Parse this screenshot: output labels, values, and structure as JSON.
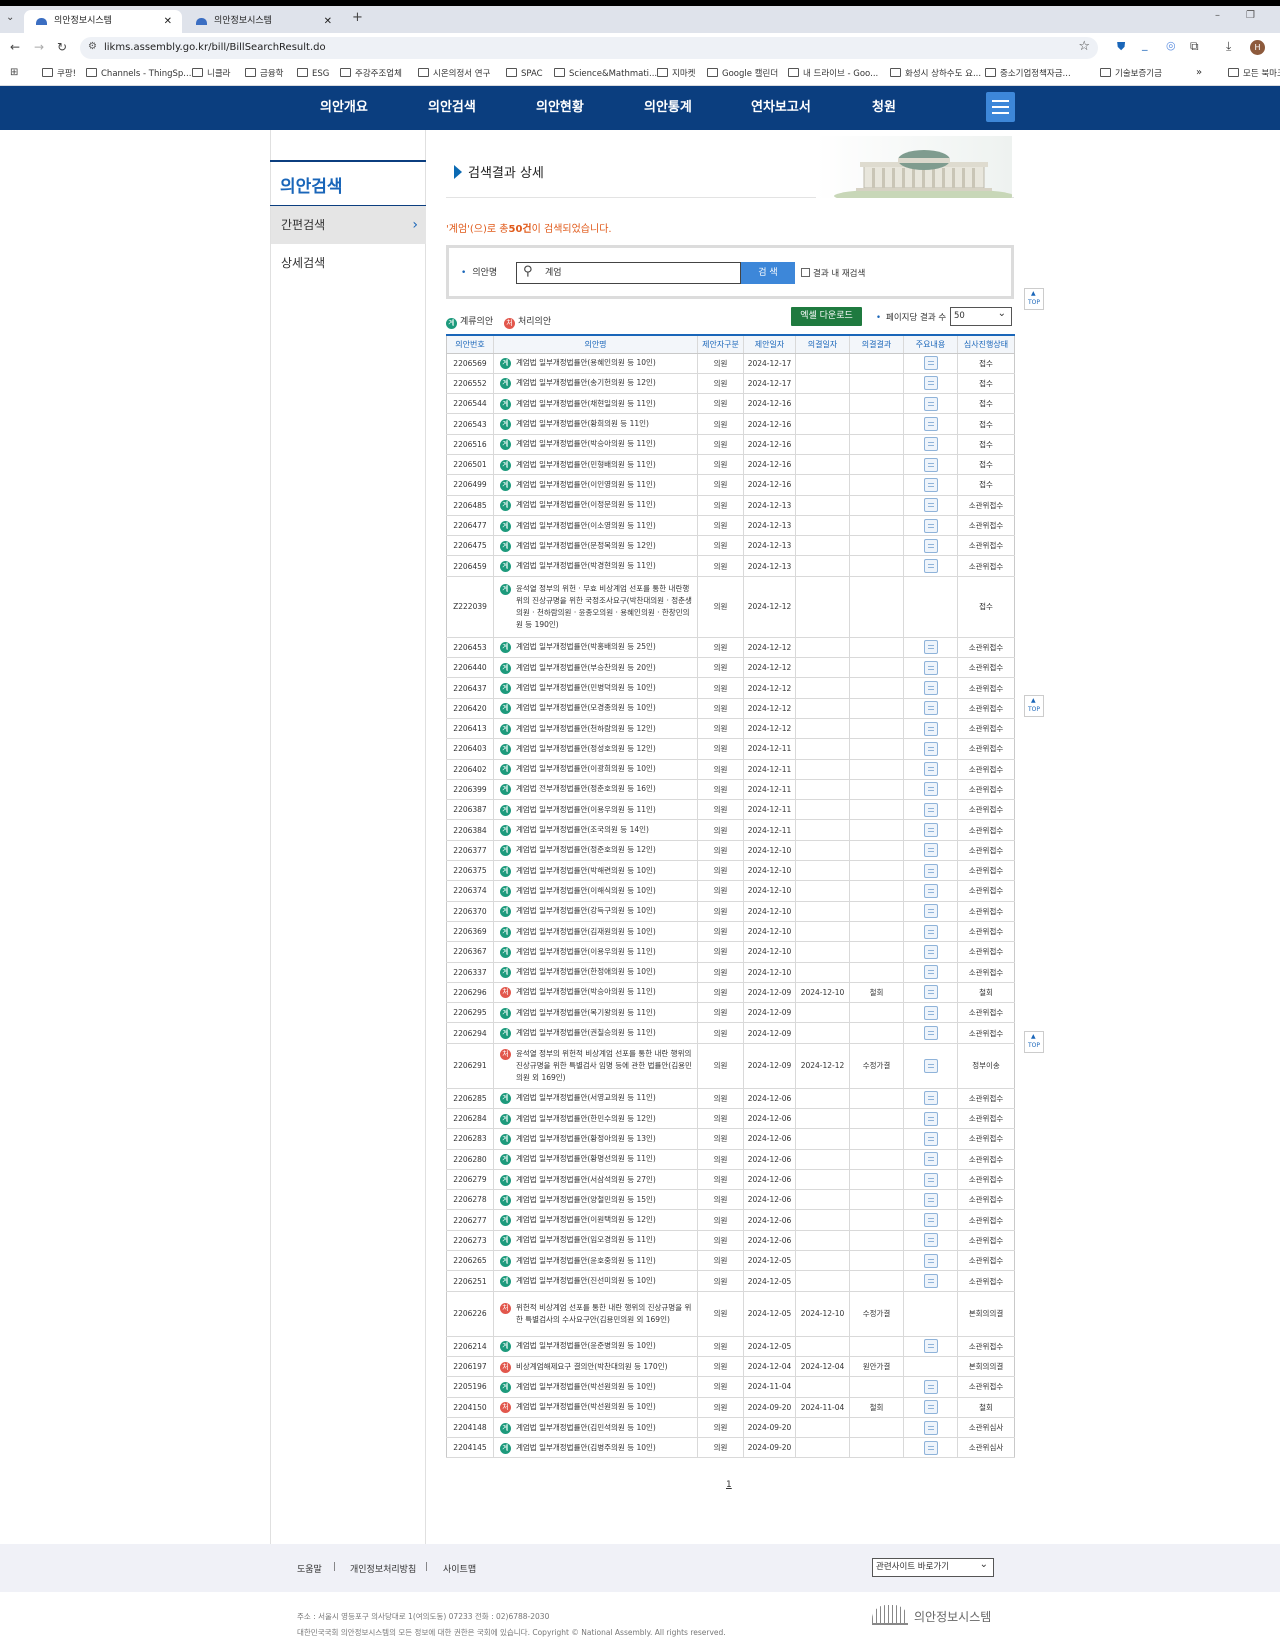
{
  "browser": {
    "tabs": [
      {
        "label": "의안정보시스템",
        "active": true
      },
      {
        "label": "의안정보시스템",
        "active": false
      }
    ],
    "url": "likms.assembly.go.kr/bill/BillSearchResult.do",
    "bookmarks": [
      "쿠팡!",
      "Channels - ThingSp...",
      "니클라",
      "금융학",
      "ESG",
      "주강주조업체",
      "시온의정서 연구",
      "SPAC",
      "Science&Mathmati...",
      "지마켓",
      "Google 캘린더",
      "내 드라이브 - Goo...",
      "화성시 상하수도 요...",
      "중소기업정책자금...",
      "기술보증기금",
      "모든 북마크"
    ]
  },
  "gnb": {
    "items": [
      "의안개요",
      "의안검색",
      "의안현황",
      "의안통계",
      "연차보고서",
      "청원"
    ]
  },
  "lnb": {
    "title": "의안검색",
    "items": [
      "간편검색",
      "상세검색"
    ]
  },
  "page": {
    "title": "검색결과 상세",
    "result_message_prefix": "'계엄'(으)로 총",
    "result_count": "50건",
    "result_message_suffix": "이 검색되었습니다."
  },
  "search": {
    "label": "의안명",
    "value": "계엄",
    "button": "검 색",
    "recheck_label": "결과 내 재검색"
  },
  "legend": {
    "pending": "계류의안",
    "processed": "처리의안",
    "pending_badge": "계",
    "processed_badge": "처"
  },
  "toolbar": {
    "excel": "엑셀 다운로드",
    "perpage_label": "페이지당 결과 수",
    "perpage_value": "50"
  },
  "table": {
    "headers": [
      "의안번호",
      "의안명",
      "제안자구분",
      "제안일자",
      "의결일자",
      "의결결과",
      "주요내용",
      "심사진행상태"
    ],
    "rows": [
      {
        "no": "2206569",
        "t": "g",
        "name": "계엄법 일부개정법률안(용혜인의원 등 10인)",
        "prop": "의원",
        "date": "2024-12-17",
        "vdate": "",
        "vres": "",
        "doc": true,
        "status": "접수"
      },
      {
        "no": "2206552",
        "t": "g",
        "name": "계엄법 일부개정법률안(송기헌의원 등 12인)",
        "prop": "의원",
        "date": "2024-12-17",
        "vdate": "",
        "vres": "",
        "doc": true,
        "status": "접수"
      },
      {
        "no": "2206544",
        "t": "g",
        "name": "계엄법 일부개정법률안(채현일의원 등 11인)",
        "prop": "의원",
        "date": "2024-12-16",
        "vdate": "",
        "vres": "",
        "doc": true,
        "status": "접수"
      },
      {
        "no": "2206543",
        "t": "g",
        "name": "계엄법 일부개정법률안(황희의원 등 11인)",
        "prop": "의원",
        "date": "2024-12-16",
        "vdate": "",
        "vres": "",
        "doc": true,
        "status": "접수"
      },
      {
        "no": "2206516",
        "t": "g",
        "name": "계엄법 일부개정법률안(박승아의원 등 11인)",
        "prop": "의원",
        "date": "2024-12-16",
        "vdate": "",
        "vres": "",
        "doc": true,
        "status": "접수"
      },
      {
        "no": "2206501",
        "t": "g",
        "name": "계엄법 일부개정법률안(민형배의원 등 11인)",
        "prop": "의원",
        "date": "2024-12-16",
        "vdate": "",
        "vres": "",
        "doc": true,
        "status": "접수"
      },
      {
        "no": "2206499",
        "t": "g",
        "name": "계엄법 일부개정법률안(이인영의원 등 11인)",
        "prop": "의원",
        "date": "2024-12-16",
        "vdate": "",
        "vres": "",
        "doc": true,
        "status": "접수"
      },
      {
        "no": "2206485",
        "t": "g",
        "name": "계엄법 일부개정법률안(이정문의원 등 11인)",
        "prop": "의원",
        "date": "2024-12-13",
        "vdate": "",
        "vres": "",
        "doc": true,
        "status": "소관위접수"
      },
      {
        "no": "2206477",
        "t": "g",
        "name": "계엄법 일부개정법률안(이소영의원 등 11인)",
        "prop": "의원",
        "date": "2024-12-13",
        "vdate": "",
        "vres": "",
        "doc": true,
        "status": "소관위접수"
      },
      {
        "no": "2206475",
        "t": "g",
        "name": "계엄법 일부개정법률안(문정복의원 등 12인)",
        "prop": "의원",
        "date": "2024-12-13",
        "vdate": "",
        "vres": "",
        "doc": true,
        "status": "소관위접수"
      },
      {
        "no": "2206459",
        "t": "g",
        "name": "계엄법 일부개정법률안(박경현의원 등 11인)",
        "prop": "의원",
        "date": "2024-12-13",
        "vdate": "",
        "vres": "",
        "doc": true,
        "status": "소관위접수"
      },
      {
        "no": "Z222039",
        "t": "g",
        "name": "윤석열 정부의 위헌 · 무효 비상계엄 선포를 통한 내란행위의 진상규명을 위한 국정조사요구(박찬대의원 · 정춘생의원 · 천하람의원 · 윤종오의원 · 용혜인의원 · 한창민의원 등 190인)",
        "prop": "의원",
        "date": "2024-12-12",
        "vdate": "",
        "vres": "",
        "doc": false,
        "status": "접수",
        "size": "tall"
      },
      {
        "no": "2206453",
        "t": "g",
        "name": "계엄법 일부개정법률안(박홍배의원 등 25인)",
        "prop": "의원",
        "date": "2024-12-12",
        "vdate": "",
        "vres": "",
        "doc": true,
        "status": "소관위접수"
      },
      {
        "no": "2206440",
        "t": "g",
        "name": "계엄법 일부개정법률안(부승찬의원 등 20인)",
        "prop": "의원",
        "date": "2024-12-12",
        "vdate": "",
        "vres": "",
        "doc": true,
        "status": "소관위접수"
      },
      {
        "no": "2206437",
        "t": "g",
        "name": "계엄법 일부개정법률안(민병덕의원 등 10인)",
        "prop": "의원",
        "date": "2024-12-12",
        "vdate": "",
        "vres": "",
        "doc": true,
        "status": "소관위접수"
      },
      {
        "no": "2206420",
        "t": "g",
        "name": "계엄법 일부개정법률안(모경종의원 등 10인)",
        "prop": "의원",
        "date": "2024-12-12",
        "vdate": "",
        "vres": "",
        "doc": true,
        "status": "소관위접수"
      },
      {
        "no": "2206413",
        "t": "g",
        "name": "계엄법 일부개정법률안(천하람의원 등 12인)",
        "prop": "의원",
        "date": "2024-12-12",
        "vdate": "",
        "vres": "",
        "doc": true,
        "status": "소관위접수"
      },
      {
        "no": "2206403",
        "t": "g",
        "name": "계엄법 일부개정법률안(정성호의원 등 12인)",
        "prop": "의원",
        "date": "2024-12-11",
        "vdate": "",
        "vres": "",
        "doc": true,
        "status": "소관위접수"
      },
      {
        "no": "2206402",
        "t": "g",
        "name": "계엄법 일부개정법률안(이광희의원 등 10인)",
        "prop": "의원",
        "date": "2024-12-11",
        "vdate": "",
        "vres": "",
        "doc": true,
        "status": "소관위접수"
      },
      {
        "no": "2206399",
        "t": "g",
        "name": "계엄법 전부개정법률안(정춘호의원 등 16인)",
        "prop": "의원",
        "date": "2024-12-11",
        "vdate": "",
        "vres": "",
        "doc": true,
        "status": "소관위접수"
      },
      {
        "no": "2206387",
        "t": "g",
        "name": "계엄법 일부개정법률안(이용우의원 등 11인)",
        "prop": "의원",
        "date": "2024-12-11",
        "vdate": "",
        "vres": "",
        "doc": true,
        "status": "소관위접수"
      },
      {
        "no": "2206384",
        "t": "g",
        "name": "계엄법 일부개정법률안(조국의원 등 14인)",
        "prop": "의원",
        "date": "2024-12-11",
        "vdate": "",
        "vres": "",
        "doc": true,
        "status": "소관위접수"
      },
      {
        "no": "2206377",
        "t": "g",
        "name": "계엄법 일부개정법률안(정준호의원 등 12인)",
        "prop": "의원",
        "date": "2024-12-10",
        "vdate": "",
        "vres": "",
        "doc": true,
        "status": "소관위접수"
      },
      {
        "no": "2206375",
        "t": "g",
        "name": "계엄법 일부개정법률안(박해련의원 등 10인)",
        "prop": "의원",
        "date": "2024-12-10",
        "vdate": "",
        "vres": "",
        "doc": true,
        "status": "소관위접수"
      },
      {
        "no": "2206374",
        "t": "g",
        "name": "계엄법 일부개정법률안(이해식의원 등 10인)",
        "prop": "의원",
        "date": "2024-12-10",
        "vdate": "",
        "vres": "",
        "doc": true,
        "status": "소관위접수"
      },
      {
        "no": "2206370",
        "t": "g",
        "name": "계엄법 일부개정법률안(강득구의원 등 10인)",
        "prop": "의원",
        "date": "2024-12-10",
        "vdate": "",
        "vres": "",
        "doc": true,
        "status": "소관위접수"
      },
      {
        "no": "2206369",
        "t": "g",
        "name": "계엄법 일부개정법률안(김재원의원 등 10인)",
        "prop": "의원",
        "date": "2024-12-10",
        "vdate": "",
        "vres": "",
        "doc": true,
        "status": "소관위접수"
      },
      {
        "no": "2206367",
        "t": "g",
        "name": "계엄법 일부개정법률안(이용우의원 등 11인)",
        "prop": "의원",
        "date": "2024-12-10",
        "vdate": "",
        "vres": "",
        "doc": true,
        "status": "소관위접수"
      },
      {
        "no": "2206337",
        "t": "g",
        "name": "계엄법 일부개정법률안(한정애의원 등 10인)",
        "prop": "의원",
        "date": "2024-12-10",
        "vdate": "",
        "vres": "",
        "doc": true,
        "status": "소관위접수"
      },
      {
        "no": "2206296",
        "t": "r",
        "name": "계엄법 일부개정법률안(박승아의원 등 11인)",
        "prop": "의원",
        "date": "2024-12-09",
        "vdate": "2024-12-10",
        "vres": "철회",
        "doc": true,
        "status": "철회"
      },
      {
        "no": "2206295",
        "t": "g",
        "name": "계엄법 일부개정법률안(복기왕의원 등 11인)",
        "prop": "의원",
        "date": "2024-12-09",
        "vdate": "",
        "vres": "",
        "doc": true,
        "status": "소관위접수"
      },
      {
        "no": "2206294",
        "t": "g",
        "name": "계엄법 일부개정법률안(권칠승의원 등 11인)",
        "prop": "의원",
        "date": "2024-12-09",
        "vdate": "",
        "vres": "",
        "doc": true,
        "status": "소관위접수"
      },
      {
        "no": "2206291",
        "t": "r",
        "name": "윤석열 정부의 위헌적 비상계엄 선포를 통한 내란 행위의 진상규명을 위한 특별검사 임명 등에 관한 법률안(김용민의원 외 169인)",
        "prop": "의원",
        "date": "2024-12-09",
        "vdate": "2024-12-12",
        "vres": "수정가결",
        "doc": true,
        "status": "정부이송",
        "size": "mid"
      },
      {
        "no": "2206285",
        "t": "g",
        "name": "계엄법 일부개정법률안(서영교의원 등 11인)",
        "prop": "의원",
        "date": "2024-12-06",
        "vdate": "",
        "vres": "",
        "doc": true,
        "status": "소관위접수"
      },
      {
        "no": "2206284",
        "t": "g",
        "name": "계엄법 일부개정법률안(한민수의원 등 12인)",
        "prop": "의원",
        "date": "2024-12-06",
        "vdate": "",
        "vres": "",
        "doc": true,
        "status": "소관위접수"
      },
      {
        "no": "2206283",
        "t": "g",
        "name": "계엄법 일부개정법률안(황정아의원 등 13인)",
        "prop": "의원",
        "date": "2024-12-06",
        "vdate": "",
        "vres": "",
        "doc": true,
        "status": "소관위접수"
      },
      {
        "no": "2206280",
        "t": "g",
        "name": "계엄법 일부개정법률안(황명선의원 등 11인)",
        "prop": "의원",
        "date": "2024-12-06",
        "vdate": "",
        "vres": "",
        "doc": true,
        "status": "소관위접수"
      },
      {
        "no": "2206279",
        "t": "g",
        "name": "계엄법 일부개정법률안(서삼석의원 등 27인)",
        "prop": "의원",
        "date": "2024-12-06",
        "vdate": "",
        "vres": "",
        "doc": true,
        "status": "소관위접수"
      },
      {
        "no": "2206278",
        "t": "g",
        "name": "계엄법 일부개정법률안(양철민의원 등 15인)",
        "prop": "의원",
        "date": "2024-12-06",
        "vdate": "",
        "vres": "",
        "doc": true,
        "status": "소관위접수"
      },
      {
        "no": "2206277",
        "t": "g",
        "name": "계엄법 일부개정법률안(이원택의원 등 12인)",
        "prop": "의원",
        "date": "2024-12-06",
        "vdate": "",
        "vres": "",
        "doc": true,
        "status": "소관위접수"
      },
      {
        "no": "2206273",
        "t": "g",
        "name": "계엄법 일부개정법률안(임오경의원 등 11인)",
        "prop": "의원",
        "date": "2024-12-06",
        "vdate": "",
        "vres": "",
        "doc": true,
        "status": "소관위접수"
      },
      {
        "no": "2206265",
        "t": "g",
        "name": "계엄법 일부개정법률안(윤호중의원 등 11인)",
        "prop": "의원",
        "date": "2024-12-05",
        "vdate": "",
        "vres": "",
        "doc": true,
        "status": "소관위접수"
      },
      {
        "no": "2206251",
        "t": "g",
        "name": "계엄법 일부개정법률안(진선미의원 등 10인)",
        "prop": "의원",
        "date": "2024-12-05",
        "vdate": "",
        "vres": "",
        "doc": true,
        "status": "소관위접수"
      },
      {
        "no": "2206226",
        "t": "r",
        "name": "위헌적 비상계엄 선포를 통한 내란 행위의 진상규명을 위한 특별검사의 수사요구안(김용민의원 외 169인)",
        "prop": "의원",
        "date": "2024-12-05",
        "vdate": "2024-12-10",
        "vres": "수정가결",
        "doc": false,
        "status": "본회의의결",
        "size": "mid"
      },
      {
        "no": "2206214",
        "t": "g",
        "name": "계엄법 일부개정법률안(윤준병의원 등 10인)",
        "prop": "의원",
        "date": "2024-12-05",
        "vdate": "",
        "vres": "",
        "doc": true,
        "status": "소관위접수"
      },
      {
        "no": "2206197",
        "t": "r",
        "name": "비상계엄해제요구 결의안(박찬대의원 등 170인)",
        "prop": "의원",
        "date": "2024-12-04",
        "vdate": "2024-12-04",
        "vres": "원안가결",
        "doc": false,
        "status": "본회의의결"
      },
      {
        "no": "2205196",
        "t": "g",
        "name": "계엄법 일부개정법률안(박선원의원 등 10인)",
        "prop": "의원",
        "date": "2024-11-04",
        "vdate": "",
        "vres": "",
        "doc": true,
        "status": "소관위접수"
      },
      {
        "no": "2204150",
        "t": "r",
        "name": "계엄법 일부개정법률안(박선원의원 등 10인)",
        "prop": "의원",
        "date": "2024-09-20",
        "vdate": "2024-11-04",
        "vres": "철회",
        "doc": true,
        "status": "철회"
      },
      {
        "no": "2204148",
        "t": "g",
        "name": "계엄법 일부개정법률안(김민석의원 등 10인)",
        "prop": "의원",
        "date": "2024-09-20",
        "vdate": "",
        "vres": "",
        "doc": true,
        "status": "소관위심사"
      },
      {
        "no": "2204145",
        "t": "g",
        "name": "계엄법 일부개정법률안(김병주의원 등 10인)",
        "prop": "의원",
        "date": "2024-09-20",
        "vdate": "",
        "vres": "",
        "doc": true,
        "status": "소관위심사"
      }
    ]
  },
  "top_button": "TOP",
  "pager": {
    "current": "1"
  },
  "footer": {
    "links": [
      "도움말",
      "개인정보처리방침",
      "사이트맵"
    ],
    "related_select": "관련사이트 바로가기",
    "address": "주소 : 서울시 영등포구 의사당대로 1(여의도동) 07233    전화 : 02)6788-2030",
    "copyright": "대한민국국회 의안정보시스템의 모든 정보에 대한 권한은 국회에 있습니다. Copyright © National Assembly. All rights reserved.",
    "logo": "의안정보시스템"
  }
}
